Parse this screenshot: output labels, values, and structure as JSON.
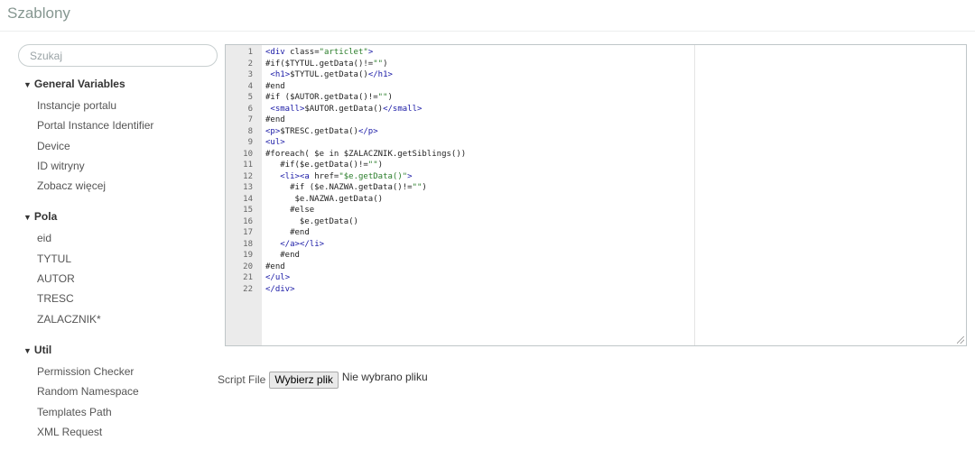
{
  "page": {
    "title": "Szablony"
  },
  "sidebar": {
    "search_placeholder": "Szukaj",
    "categories": [
      {
        "label": "General Variables",
        "items": [
          "Instancje portalu",
          "Portal Instance Identifier",
          "Device",
          "ID witryny",
          "Zobacz więcej"
        ]
      },
      {
        "label": "Pola",
        "items": [
          "eid",
          "TYTUL",
          "AUTOR",
          "TRESC",
          "ZALACZNIK*"
        ]
      },
      {
        "label": "Util",
        "items": [
          "Permission Checker",
          "Random Namespace",
          "Templates Path",
          "XML Request"
        ]
      }
    ]
  },
  "editor": {
    "lines": [
      "<div class=\"articlet\">",
      "#if($TYTUL.getData()!=\"\")",
      " <h1>$TYTUL.getData()</h1>",
      "#end",
      "#if ($AUTOR.getData()!=\"\")",
      " <small>$AUTOR.getData()</small>",
      "#end",
      "<p>$TRESC.getData()</p>",
      "<ul>",
      "#foreach( $e in $ZALACZNIK.getSiblings())",
      "   #if($e.getData()!=\"\")",
      "   <li><a href=\"$e.getData()\">",
      "     #if ($e.NAZWA.getData()!=\"\")",
      "      $e.NAZWA.getData()",
      "     #else",
      "       $e.getData()",
      "     #end",
      "   </a></li>",
      "   #end",
      "#end",
      "</ul>",
      "</div>"
    ]
  },
  "file": {
    "label": "Script File",
    "button_label": "Wybierz plik",
    "status": "Nie wybrano pliku"
  }
}
